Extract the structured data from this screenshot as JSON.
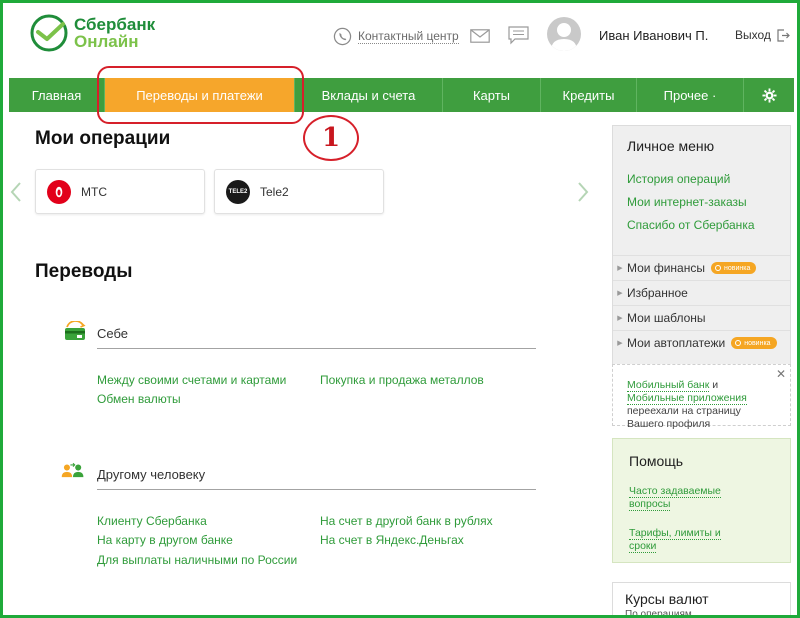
{
  "header": {
    "logo_line1": "Сбербанк",
    "logo_line2": "Онлайн",
    "contact_center": "Контактный центр",
    "user_name": "Иван Иванович П.",
    "logout": "Выход"
  },
  "nav": {
    "items": [
      {
        "label": "Главная",
        "active": false
      },
      {
        "label": "Переводы и платежи",
        "active": true
      },
      {
        "label": "Вклады и счета",
        "active": false
      },
      {
        "label": "Карты",
        "active": false
      },
      {
        "label": "Кредиты",
        "active": false
      },
      {
        "label": "Прочее ·",
        "active": false
      }
    ],
    "settings_icon": "gear-icon"
  },
  "annotation": {
    "step": "1",
    "color": "#d6202a"
  },
  "operations": {
    "title": "Мои операции",
    "cards": [
      {
        "label": "МТС",
        "icon": "mts-logo",
        "color": "#e2001a"
      },
      {
        "label": "Tele2",
        "icon": "tele2-logo",
        "color": "#1a1a1a",
        "icon_text": "TELE2"
      }
    ]
  },
  "transfers": {
    "title": "Переводы",
    "self": {
      "title": "Себе",
      "links": [
        "Между своими счетами и картами",
        "Обмен валюты",
        "Покупка и продажа металлов"
      ]
    },
    "other": {
      "title": "Другому человеку",
      "links": [
        "Клиенту Сбербанка",
        "На карту в другом банке",
        "Для выплаты наличными по России",
        "На счет в другой банк в рублях",
        "На счет в Яндекс.Деньгах"
      ]
    }
  },
  "sidebar": {
    "title": "Личное меню",
    "links": [
      "История операций",
      "Мои интернет-заказы",
      "Спасибо от Сбербанка"
    ],
    "rows": [
      {
        "label": "Мои финансы",
        "badge": "новинка"
      },
      {
        "label": "Избранное",
        "badge": ""
      },
      {
        "label": "Мои шаблоны",
        "badge": ""
      },
      {
        "label": "Мои автоплатежи",
        "badge": "новинка"
      }
    ]
  },
  "notice": {
    "link1": "Мобильный банк",
    "and": " и ",
    "link2": "Мобильные приложения",
    "rest": " переехали на страницу Вашего профиля"
  },
  "help": {
    "title": "Помощь",
    "links": [
      "Часто задаваемые вопросы",
      "Тарифы, лимиты и сроки"
    ]
  },
  "rates": {
    "title": "Курсы валют",
    "subtitle": "По операциям"
  },
  "colors": {
    "brand_green": "#1f8d3a",
    "nav_green": "#3f9e3f",
    "active_orange": "#f6a62b",
    "link_green": "#2f9b3a",
    "badge_orange": "#f5a623"
  }
}
